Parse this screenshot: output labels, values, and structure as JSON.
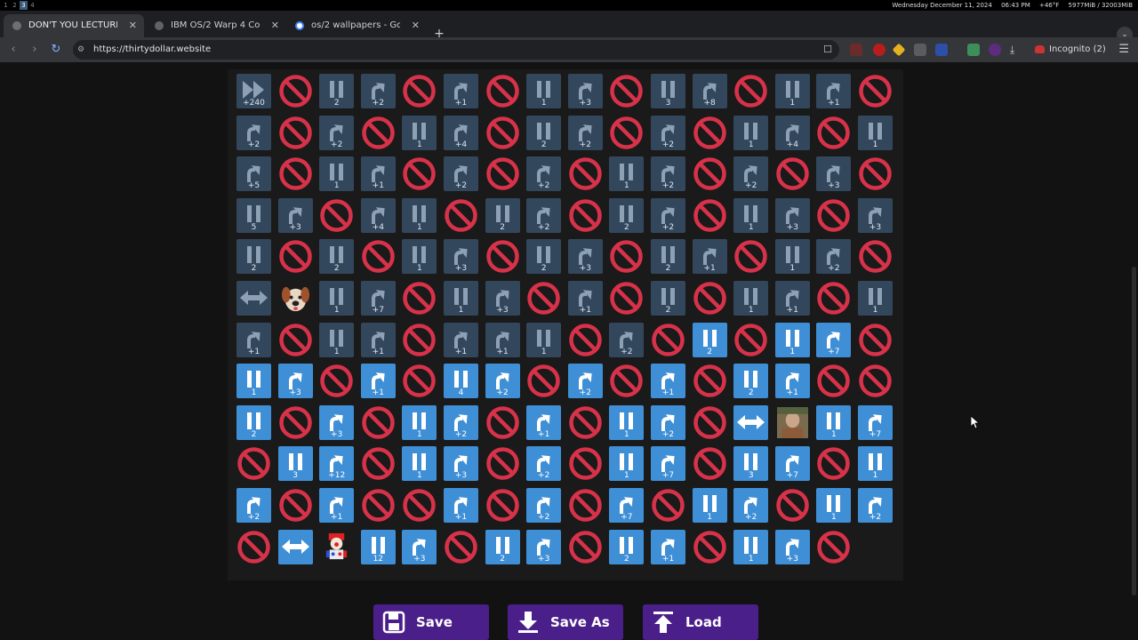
{
  "os_bar": {
    "workspaces": [
      "1",
      "2",
      "3",
      "4"
    ],
    "active_workspace": "3",
    "date": "Wednesday December 11, 2024",
    "time": "06:43 PM",
    "weather": "+46°F",
    "memory": "5977MiB / 32003MiB"
  },
  "browser": {
    "tabs": [
      {
        "title": "DON'T YOU LECTURE M",
        "active": true
      },
      {
        "title": "IBM OS/2 Warp 4 Collectio",
        "active": false
      },
      {
        "title": "os/2 wallpapers - Google",
        "active": false
      }
    ],
    "new_tab": "+",
    "url": "https://thirtydollar.website",
    "incognito_label": "Incognito (2)"
  },
  "sequencer": {
    "columns": 16,
    "cells": [
      [
        "ff",
        "+240",
        0
      ],
      [
        "no",
        "",
        0
      ],
      [
        "pause",
        "2",
        0
      ],
      [
        "up",
        "+2",
        0
      ],
      [
        "no",
        "",
        0
      ],
      [
        "up",
        "+1",
        0
      ],
      [
        "no",
        "",
        0
      ],
      [
        "pause",
        "1",
        0
      ],
      [
        "up",
        "+3",
        0
      ],
      [
        "no",
        "",
        0
      ],
      [
        "pause",
        "3",
        0
      ],
      [
        "up",
        "+8",
        0
      ],
      [
        "no",
        "",
        0
      ],
      [
        "pause",
        "1",
        0
      ],
      [
        "up",
        "+1",
        0
      ],
      [
        "no",
        "",
        0
      ],
      [
        "up",
        "+2",
        0
      ],
      [
        "no",
        "",
        0
      ],
      [
        "up",
        "+2",
        0
      ],
      [
        "no",
        "",
        0
      ],
      [
        "pause",
        "1",
        0
      ],
      [
        "up",
        "+4",
        0
      ],
      [
        "no",
        "",
        0
      ],
      [
        "pause",
        "2",
        0
      ],
      [
        "up",
        "+2",
        0
      ],
      [
        "no",
        "",
        0
      ],
      [
        "up",
        "+2",
        0
      ],
      [
        "no",
        "",
        0
      ],
      [
        "pause",
        "1",
        0
      ],
      [
        "up",
        "+4",
        0
      ],
      [
        "no",
        "",
        0
      ],
      [
        "pause",
        "1",
        0
      ],
      [
        "up",
        "+5",
        0
      ],
      [
        "no",
        "",
        0
      ],
      [
        "pause",
        "1",
        0
      ],
      [
        "up",
        "+1",
        0
      ],
      [
        "no",
        "",
        0
      ],
      [
        "up",
        "+2",
        0
      ],
      [
        "no",
        "",
        0
      ],
      [
        "up",
        "+2",
        0
      ],
      [
        "no",
        "",
        0
      ],
      [
        "pause",
        "1",
        0
      ],
      [
        "up",
        "+2",
        0
      ],
      [
        "no",
        "",
        0
      ],
      [
        "up",
        "+2",
        0
      ],
      [
        "no",
        "",
        0
      ],
      [
        "up",
        "+3",
        0
      ],
      [
        "no",
        "",
        0
      ],
      [
        "pause",
        "5",
        0
      ],
      [
        "up",
        "+3",
        0
      ],
      [
        "no",
        "",
        0
      ],
      [
        "up",
        "+4",
        0
      ],
      [
        "pause",
        "1",
        0
      ],
      [
        "no",
        "",
        0
      ],
      [
        "pause",
        "2",
        0
      ],
      [
        "up",
        "+2",
        0
      ],
      [
        "no",
        "",
        0
      ],
      [
        "pause",
        "2",
        0
      ],
      [
        "up",
        "+2",
        0
      ],
      [
        "no",
        "",
        0
      ],
      [
        "pause",
        "1",
        0
      ],
      [
        "up",
        "+3",
        0
      ],
      [
        "no",
        "",
        0
      ],
      [
        "up",
        "+3",
        0
      ],
      [
        "pause",
        "2",
        0
      ],
      [
        "no",
        "",
        0
      ],
      [
        "pause",
        "2",
        0
      ],
      [
        "no",
        "",
        0
      ],
      [
        "pause",
        "1",
        0
      ],
      [
        "up",
        "+3",
        0
      ],
      [
        "no",
        "",
        0
      ],
      [
        "pause",
        "2",
        0
      ],
      [
        "up",
        "+3",
        0
      ],
      [
        "no",
        "",
        0
      ],
      [
        "pause",
        "2",
        0
      ],
      [
        "up",
        "+1",
        0
      ],
      [
        "no",
        "",
        0
      ],
      [
        "pause",
        "1",
        0
      ],
      [
        "up",
        "+2",
        0
      ],
      [
        "no",
        "",
        0
      ],
      [
        "swap",
        "",
        0
      ],
      [
        "dog",
        "",
        0
      ],
      [
        "pause",
        "1",
        0
      ],
      [
        "up",
        "+7",
        0
      ],
      [
        "no",
        "",
        0
      ],
      [
        "pause",
        "1",
        0
      ],
      [
        "up",
        "+3",
        0
      ],
      [
        "no",
        "",
        0
      ],
      [
        "up",
        "+1",
        0
      ],
      [
        "no",
        "",
        0
      ],
      [
        "pause",
        "2",
        0
      ],
      [
        "no",
        "",
        0
      ],
      [
        "pause",
        "1",
        0
      ],
      [
        "up",
        "+1",
        0
      ],
      [
        "no",
        "",
        0
      ],
      [
        "pause",
        "1",
        0
      ],
      [
        "up",
        "+1",
        0
      ],
      [
        "no",
        "",
        0
      ],
      [
        "pause",
        "1",
        0
      ],
      [
        "up",
        "+1",
        0
      ],
      [
        "no",
        "",
        0
      ],
      [
        "up",
        "+1",
        0
      ],
      [
        "up",
        "+1",
        0
      ],
      [
        "pause",
        "1",
        0
      ],
      [
        "no",
        "",
        0
      ],
      [
        "up",
        "+2",
        0
      ],
      [
        "no",
        "",
        0
      ],
      [
        "pause",
        "2",
        1
      ],
      [
        "no",
        "",
        0
      ],
      [
        "pause",
        "1",
        1
      ],
      [
        "up",
        "+7",
        1
      ],
      [
        "no",
        "",
        0
      ],
      [
        "pause",
        "1",
        1
      ],
      [
        "up",
        "+3",
        1
      ],
      [
        "no",
        "",
        0
      ],
      [
        "up",
        "+1",
        1
      ],
      [
        "no",
        "",
        0
      ],
      [
        "pause",
        "4",
        1
      ],
      [
        "up",
        "+2",
        1
      ],
      [
        "no",
        "",
        0
      ],
      [
        "up",
        "+2",
        1
      ],
      [
        "no",
        "",
        0
      ],
      [
        "up",
        "+1",
        1
      ],
      [
        "no",
        "",
        0
      ],
      [
        "pause",
        "2",
        1
      ],
      [
        "up",
        "+1",
        1
      ],
      [
        "no",
        "",
        0
      ],
      [
        "no",
        "",
        0
      ],
      [
        "pause",
        "2",
        1
      ],
      [
        "no",
        "",
        0
      ],
      [
        "up",
        "+3",
        1
      ],
      [
        "no",
        "",
        0
      ],
      [
        "pause",
        "1",
        1
      ],
      [
        "up",
        "+2",
        1
      ],
      [
        "no",
        "",
        0
      ],
      [
        "up",
        "+1",
        1
      ],
      [
        "no",
        "",
        0
      ],
      [
        "pause",
        "1",
        1
      ],
      [
        "up",
        "+2",
        1
      ],
      [
        "no",
        "",
        0
      ],
      [
        "swap",
        "",
        1
      ],
      [
        "photo",
        "",
        1
      ],
      [
        "pause",
        "1",
        1
      ],
      [
        "up",
        "+7",
        1
      ],
      [
        "no",
        "",
        0
      ],
      [
        "pause",
        "3",
        1
      ],
      [
        "up",
        "+12",
        1
      ],
      [
        "no",
        "",
        0
      ],
      [
        "pause",
        "1",
        1
      ],
      [
        "up",
        "+3",
        1
      ],
      [
        "no",
        "",
        0
      ],
      [
        "up",
        "+2",
        1
      ],
      [
        "no",
        "",
        0
      ],
      [
        "pause",
        "1",
        1
      ],
      [
        "up",
        "+7",
        1
      ],
      [
        "no",
        "",
        0
      ],
      [
        "pause",
        "3",
        1
      ],
      [
        "up",
        "+7",
        1
      ],
      [
        "no",
        "",
        0
      ],
      [
        "pause",
        "1",
        1
      ],
      [
        "up",
        "+2",
        1
      ],
      [
        "no",
        "",
        0
      ],
      [
        "up",
        "+1",
        1
      ],
      [
        "no",
        "",
        0
      ],
      [
        "no",
        "",
        0
      ],
      [
        "up",
        "+1",
        1
      ],
      [
        "no",
        "",
        0
      ],
      [
        "up",
        "+2",
        1
      ],
      [
        "no",
        "",
        0
      ],
      [
        "up",
        "+7",
        1
      ],
      [
        "no",
        "",
        0
      ],
      [
        "pause",
        "1",
        1
      ],
      [
        "up",
        "+2",
        1
      ],
      [
        "no",
        "",
        0
      ],
      [
        "pause",
        "1",
        1
      ],
      [
        "up",
        "+2",
        1
      ],
      [
        "no",
        "",
        0
      ],
      [
        "swap",
        "",
        1
      ],
      [
        "clown",
        "",
        1
      ],
      [
        "pause",
        "12",
        1
      ],
      [
        "up",
        "+3",
        1
      ],
      [
        "no",
        "",
        0
      ],
      [
        "pause",
        "2",
        1
      ],
      [
        "up",
        "+3",
        1
      ],
      [
        "no",
        "",
        0
      ],
      [
        "pause",
        "2",
        1
      ],
      [
        "up",
        "+1",
        1
      ],
      [
        "no",
        "",
        0
      ],
      [
        "pause",
        "1",
        1
      ],
      [
        "up",
        "+3",
        1
      ],
      [
        "no",
        "",
        0
      ]
    ]
  },
  "actions": {
    "save": "Save",
    "save_as": "Save As",
    "load": "Load"
  },
  "colors": {
    "active_tile": "#3f8fd6",
    "dim_tile": "#33475c",
    "stop_red": "#d8324a",
    "button_purple": "#4b1f8a"
  }
}
